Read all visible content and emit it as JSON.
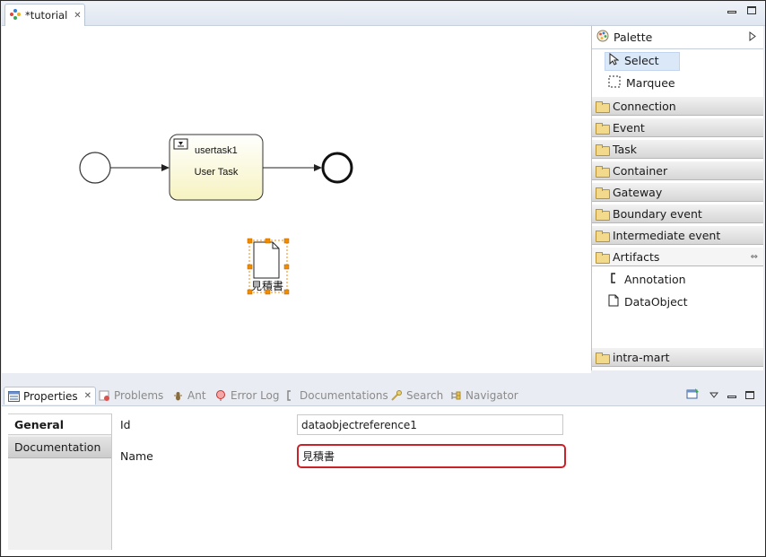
{
  "editor": {
    "tab_title": "*tutorial"
  },
  "diagram": {
    "task_id": "usertask1",
    "task_type": "User Task",
    "data_object_label": "見積書"
  },
  "palette": {
    "title": "Palette",
    "tools": [
      {
        "label": "Select",
        "selected": true
      },
      {
        "label": "Marquee",
        "selected": false
      }
    ],
    "drawers": [
      {
        "label": "Connection"
      },
      {
        "label": "Event"
      },
      {
        "label": "Task"
      },
      {
        "label": "Container"
      },
      {
        "label": "Gateway"
      },
      {
        "label": "Boundary event"
      },
      {
        "label": "Intermediate event"
      }
    ],
    "artifacts": {
      "label": "Artifacts",
      "items": [
        {
          "label": "Annotation"
        },
        {
          "label": "DataObject"
        }
      ]
    },
    "bottom_drawer": "intra-mart"
  },
  "views": {
    "tabs": [
      {
        "label": "Properties",
        "icon": "properties-icon",
        "active": true
      },
      {
        "label": "Problems",
        "icon": "problems-icon",
        "active": false
      },
      {
        "label": "Ant",
        "icon": "ant-icon",
        "active": false
      },
      {
        "label": "Error Log",
        "icon": "error-log-icon",
        "active": false
      },
      {
        "label": "Documentations",
        "icon": "documentations-icon",
        "active": false
      },
      {
        "label": "Search",
        "icon": "search-icon",
        "active": false
      },
      {
        "label": "Navigator",
        "icon": "navigator-icon",
        "active": false
      }
    ]
  },
  "properties": {
    "sections": [
      "General",
      "Documentation"
    ],
    "id_label": "Id",
    "id_value": "dataobjectreference1",
    "name_label": "Name",
    "name_value": "見積書"
  },
  "colors": {
    "task_fill": "#fbf9d6",
    "selection_handle": "#f08c00",
    "focus_border": "#c8222a"
  }
}
